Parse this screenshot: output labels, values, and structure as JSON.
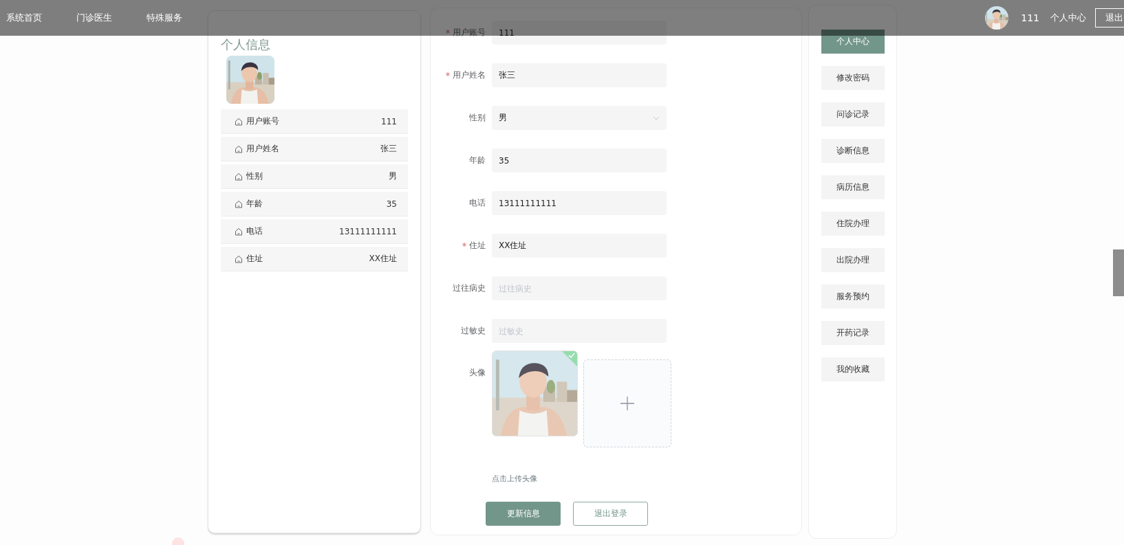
{
  "header": {
    "nav": [
      {
        "label": "系统首页"
      },
      {
        "label": "门诊医生"
      },
      {
        "label": "特殊服务"
      }
    ],
    "user": {
      "name": "111",
      "center_link": "个人中心",
      "logout": "退出"
    }
  },
  "profile": {
    "title": "个人信息",
    "rows": [
      {
        "label": "用户账号",
        "value": "111"
      },
      {
        "label": "用户姓名",
        "value": "张三"
      },
      {
        "label": "性别",
        "value": "男"
      },
      {
        "label": "年龄",
        "value": "35"
      },
      {
        "label": "电话",
        "value": "13111111111"
      },
      {
        "label": "住址",
        "value": "XX住址"
      }
    ]
  },
  "form": {
    "fields": [
      {
        "kind": "input",
        "label": "用户账号",
        "required": true,
        "value": "111"
      },
      {
        "kind": "input",
        "label": "用户姓名",
        "required": true,
        "value": "张三"
      },
      {
        "kind": "select",
        "label": "性别",
        "required": false,
        "value": "男"
      },
      {
        "kind": "input",
        "label": "年龄",
        "required": false,
        "value": "35"
      },
      {
        "kind": "input",
        "label": "电话",
        "required": false,
        "value": "13111111111"
      },
      {
        "kind": "input",
        "label": "住址",
        "required": true,
        "value": "XX住址"
      },
      {
        "kind": "input",
        "label": "过往病史",
        "required": false,
        "placeholder": "过往病史"
      },
      {
        "kind": "input",
        "label": "过敏史",
        "required": false,
        "placeholder": "过敏史"
      }
    ],
    "avatar": {
      "label": "头像",
      "uploaded": true,
      "hint": "点击上传头像"
    },
    "buttons": [
      {
        "label": "更新信息",
        "kind": "primary"
      },
      {
        "label": "退出登录",
        "kind": "outline"
      }
    ]
  },
  "menu": [
    {
      "label": "个人中心",
      "selected": true
    },
    {
      "label": "修改密码",
      "selected": false
    },
    {
      "label": "问诊记录",
      "selected": false
    },
    {
      "label": "诊断信息",
      "selected": false
    },
    {
      "label": "病历信息",
      "selected": false
    },
    {
      "label": "住院办理",
      "selected": false
    },
    {
      "label": "出院办理",
      "selected": false
    },
    {
      "label": "服务预约",
      "selected": false
    },
    {
      "label": "开药记录",
      "selected": false
    },
    {
      "label": "我的收藏",
      "selected": false
    }
  ]
}
